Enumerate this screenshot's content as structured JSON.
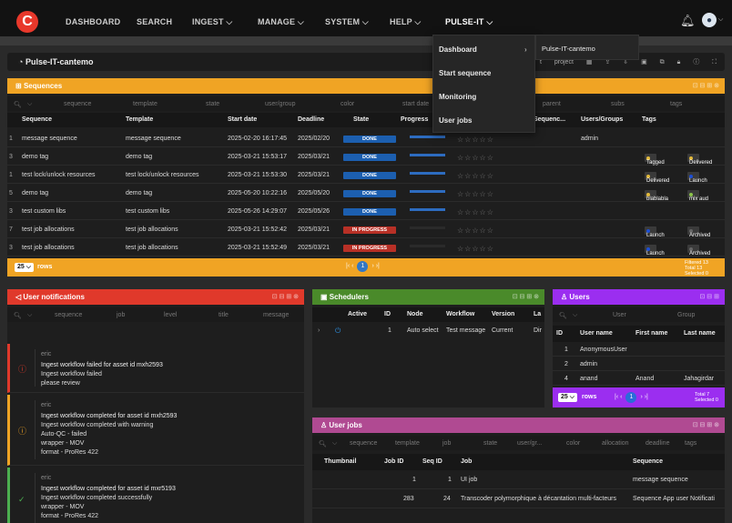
{
  "nav": {
    "items": [
      "DASHBOARD",
      "SEARCH",
      "INGEST",
      "MANAGE",
      "SYSTEM",
      "HELP",
      "PULSE-IT"
    ]
  },
  "project": {
    "title": "Pulse-IT-cantemo",
    "tools_label": "t project"
  },
  "sequences": {
    "title": "Sequences",
    "filters": [
      "sequence",
      "template",
      "state",
      "user/group",
      "color",
      "start date",
      "parent",
      "subs",
      "tags"
    ],
    "headers": [
      "Sequence",
      "Template",
      "Start date",
      "Deadline",
      "State",
      "Progress",
      "Sequenc...",
      "Users/Groups",
      "Tags"
    ],
    "rows": [
      {
        "idx": "1",
        "sequence": "message sequence",
        "template": "message sequence",
        "start": "2025-02-20 16:17:45",
        "deadline": "2025/02/20",
        "state": "DONE",
        "progress": 1,
        "users": "admin",
        "tags": []
      },
      {
        "idx": "3",
        "sequence": "demo tag",
        "template": "demo tag",
        "start": "2025-03-21 15:53:17",
        "deadline": "2025/03/21",
        "state": "DONE",
        "progress": 1,
        "users": "",
        "tags": [
          {
            "label": "Tagged",
            "color": "#e2b93b"
          },
          {
            "label": "Delivered",
            "color": "#e2b93b"
          }
        ]
      },
      {
        "idx": "1",
        "sequence": "test lock/unlock resources",
        "template": "test lock/unlock resources",
        "start": "2025-03-21 15:53:30",
        "deadline": "2025/03/21",
        "state": "DONE",
        "progress": 1,
        "users": "",
        "tags": [
          {
            "label": "Delivered",
            "color": "#e2b93b"
          },
          {
            "label": "Launch",
            "color": "#1d4fd6"
          }
        ]
      },
      {
        "idx": "5",
        "sequence": "demo tag",
        "template": "demo tag",
        "start": "2025-05-20 10:22:16",
        "deadline": "2025/05/20",
        "state": "DONE",
        "progress": 1,
        "users": "",
        "tags": [
          {
            "label": "blablabla",
            "color": "#e2b93b"
          },
          {
            "label": "mix aud",
            "color": "#8bc34a"
          }
        ]
      },
      {
        "idx": "3",
        "sequence": "test custom libs",
        "template": "test custom libs",
        "start": "2025-05-26 14:29:07",
        "deadline": "2025/05/26",
        "state": "DONE",
        "progress": 1,
        "users": "",
        "tags": []
      },
      {
        "idx": "7",
        "sequence": "test job allocations",
        "template": "test job allocations",
        "start": "2025-03-21 15:52:42",
        "deadline": "2025/03/21",
        "state": "IN PROGRESS",
        "progress": 0,
        "users": "",
        "tags": [
          {
            "label": "Launch",
            "color": "#1d4fd6"
          },
          {
            "label": "Archived",
            "color": "#666666"
          }
        ]
      },
      {
        "idx": "3",
        "sequence": "test job allocations",
        "template": "test job allocations",
        "start": "2025-03-21 15:52:49",
        "deadline": "2025/03/21",
        "state": "IN PROGRESS",
        "progress": 0,
        "users": "",
        "tags": [
          {
            "label": "Launch",
            "color": "#1d4fd6"
          },
          {
            "label": "Archived",
            "color": "#666666"
          }
        ]
      }
    ],
    "stars": "☆☆☆☆☆",
    "footer": {
      "rows": "25",
      "rows_label": "rows",
      "page": "1",
      "filtered": "Filtered 13",
      "total": "Total 13",
      "selected": "Selected 0"
    }
  },
  "notifications": {
    "title": "User notifications",
    "filters": [
      "sequence",
      "job",
      "level",
      "title",
      "message"
    ],
    "items": [
      {
        "level": "error",
        "color": "#e0392b",
        "icon": "ⓘ",
        "who": "eric",
        "lines": [
          "Ingest workflow failed for asset id mxh2593",
          "Ingest workflow failed",
          "please review"
        ]
      },
      {
        "level": "warning",
        "color": "#f0a424",
        "icon": "ⓘ",
        "who": "eric",
        "lines": [
          "Ingest workflow completed for asset id mxh2593",
          "Ingest workflow completed with warning",
          "Auto-QC - failed",
          "wrapper - MOV",
          "format - ProRes 422"
        ]
      },
      {
        "level": "success",
        "color": "#4caf50",
        "icon": "✓",
        "who": "eric",
        "lines": [
          "Ingest workflow completed for asset id mxr5193",
          "Ingest workflow completed successfully",
          "wrapper - MOV",
          "format - ProRes 422"
        ]
      }
    ]
  },
  "schedulers": {
    "title": "Schedulers",
    "headers": [
      "Active",
      "ID",
      "Node",
      "Workflow",
      "Version",
      "La"
    ],
    "row": {
      "id": "1",
      "node": "Auto select",
      "workflow": "Test message",
      "version": "Current",
      "last": "Dir"
    }
  },
  "users": {
    "title": "Users",
    "filters": [
      "User",
      "Group"
    ],
    "headers": [
      "ID",
      "User name",
      "First name",
      "Last name"
    ],
    "rows": [
      {
        "id": "1",
        "user": "AnonymousUser",
        "first": "",
        "last": ""
      },
      {
        "id": "2",
        "user": "admin",
        "first": "",
        "last": ""
      },
      {
        "id": "4",
        "user": "anand",
        "first": "Anand",
        "last": "Jahagirdar"
      }
    ],
    "footer": {
      "rows": "25",
      "rows_label": "rows",
      "page": "1",
      "total": "Total 7",
      "selected": "Selected 0"
    }
  },
  "userjobs": {
    "title": "User jobs",
    "filters": [
      "sequence",
      "template",
      "job",
      "state",
      "user/gr...",
      "color",
      "allocation",
      "deadline",
      "tags"
    ],
    "headers": [
      "Thumbnail",
      "Job ID",
      "Seq ID",
      "Job",
      "Sequence"
    ],
    "rows": [
      {
        "job_id": "1",
        "seq_id": "1",
        "job": "UI job",
        "sequence": "message sequence"
      },
      {
        "job_id": "283",
        "seq_id": "24",
        "job": "Transcoder polymorphique à décantation multi-facteurs",
        "sequence": "Sequence App user Notificati"
      }
    ]
  },
  "menu": {
    "items": [
      "Dashboard",
      "Start sequence",
      "Monitoring",
      "User jobs"
    ],
    "submenu": "Pulse-IT-cantemo"
  },
  "colors": {
    "sequences": "#f0a424",
    "notifications": "#e0392b",
    "schedulers": "#4a8a2a",
    "users": "#9b2ef0",
    "userjobs": "#b04a92"
  }
}
